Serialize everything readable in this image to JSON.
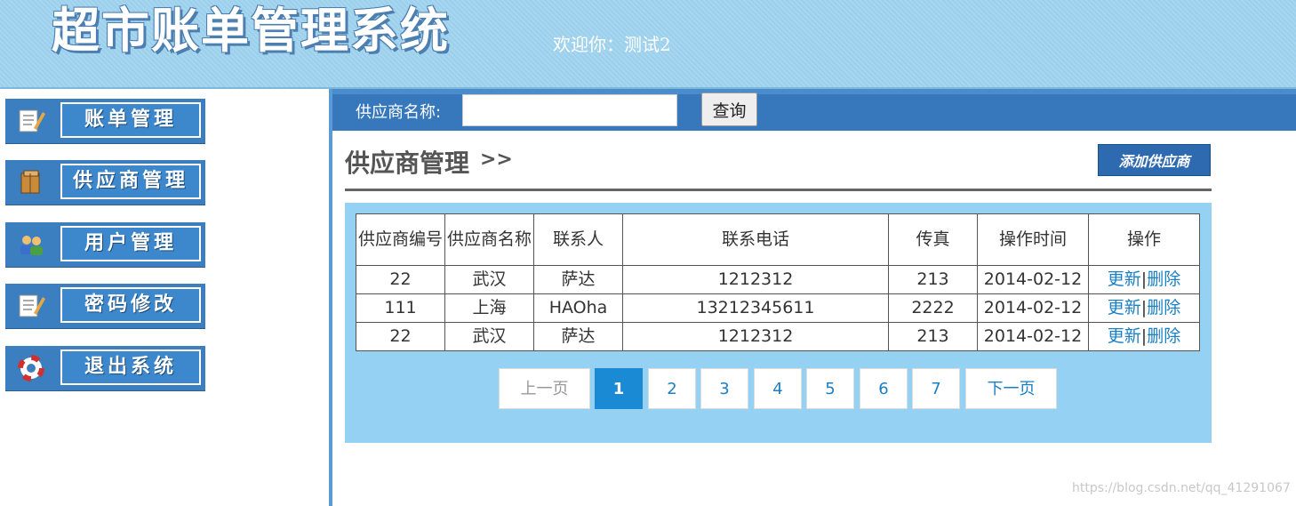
{
  "header": {
    "logo": "超市账单管理系统",
    "welcome": "欢迎你：测试2"
  },
  "sidebar": {
    "items": [
      {
        "label": "账单管理",
        "icon": "notepad-icon"
      },
      {
        "label": "供应商管理",
        "icon": "box-icon"
      },
      {
        "label": "用户管理",
        "icon": "users-icon"
      },
      {
        "label": "密码修改",
        "icon": "notepad-icon"
      },
      {
        "label": "退出系统",
        "icon": "lifebuoy-icon"
      }
    ]
  },
  "search": {
    "label": "供应商名称:",
    "value": "",
    "placeholder": "",
    "button": "查询"
  },
  "main": {
    "title": "供应商管理",
    "title_suffix": ">>",
    "add_button": "添加供应商"
  },
  "table": {
    "headers": [
      "供应商编号",
      "供应商名称",
      "联系人",
      "联系电话",
      "传真",
      "操作时间",
      "操作"
    ],
    "rows": [
      {
        "id": "22",
        "name": "武汉",
        "contact": "萨达",
        "phone": "1212312",
        "fax": "213",
        "time": "2014-02-12"
      },
      {
        "id": "111",
        "name": "上海",
        "contact": "HAOha",
        "phone": "13212345611",
        "fax": "2222",
        "time": "2014-02-12"
      },
      {
        "id": "22",
        "name": "武汉",
        "contact": "萨达",
        "phone": "1212312",
        "fax": "213",
        "time": "2014-02-12"
      }
    ],
    "action_update": "更新",
    "action_sep": "|",
    "action_delete": "删除"
  },
  "pagination": {
    "prev": "上一页",
    "pages": [
      "1",
      "2",
      "3",
      "4",
      "5",
      "6",
      "7"
    ],
    "current": "1",
    "next": "下一页"
  },
  "watermark": "https://blog.csdn.net/qq_41291067",
  "colors": {
    "header_bg": "#9fd3ef",
    "nav_blue": "#3778bd",
    "panel_bg": "#95d1f3",
    "link": "#1a7fc4",
    "active_page": "#1a8ad4"
  }
}
